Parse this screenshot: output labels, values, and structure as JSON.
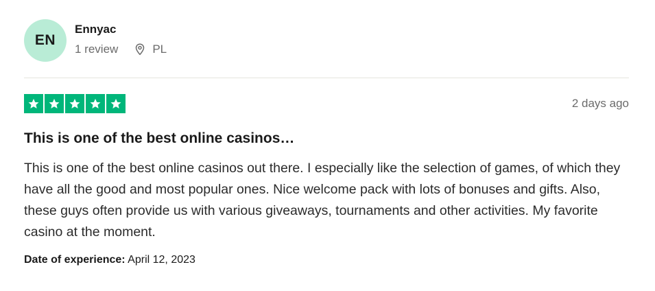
{
  "reviewer": {
    "initials": "EN",
    "name": "Ennyac",
    "review_count": "1 review",
    "country": "PL"
  },
  "review": {
    "rating": 5,
    "star_color": "#00b67a",
    "date_ago": "2 days ago",
    "title": "This is one of the best online casinos…",
    "body": "This is one of the best online casinos out there. I especially like the selection of games, of which they have all the good and most popular ones. Nice welcome pack with lots of bonuses and gifts. Also, these guys often provide us with various giveaways, tournaments and other activities. My favorite casino at the moment.",
    "experience_label": "Date of experience:",
    "experience_date": "April 12, 2023"
  },
  "icons": {
    "location": "location-pin-icon",
    "star": "star-icon"
  }
}
